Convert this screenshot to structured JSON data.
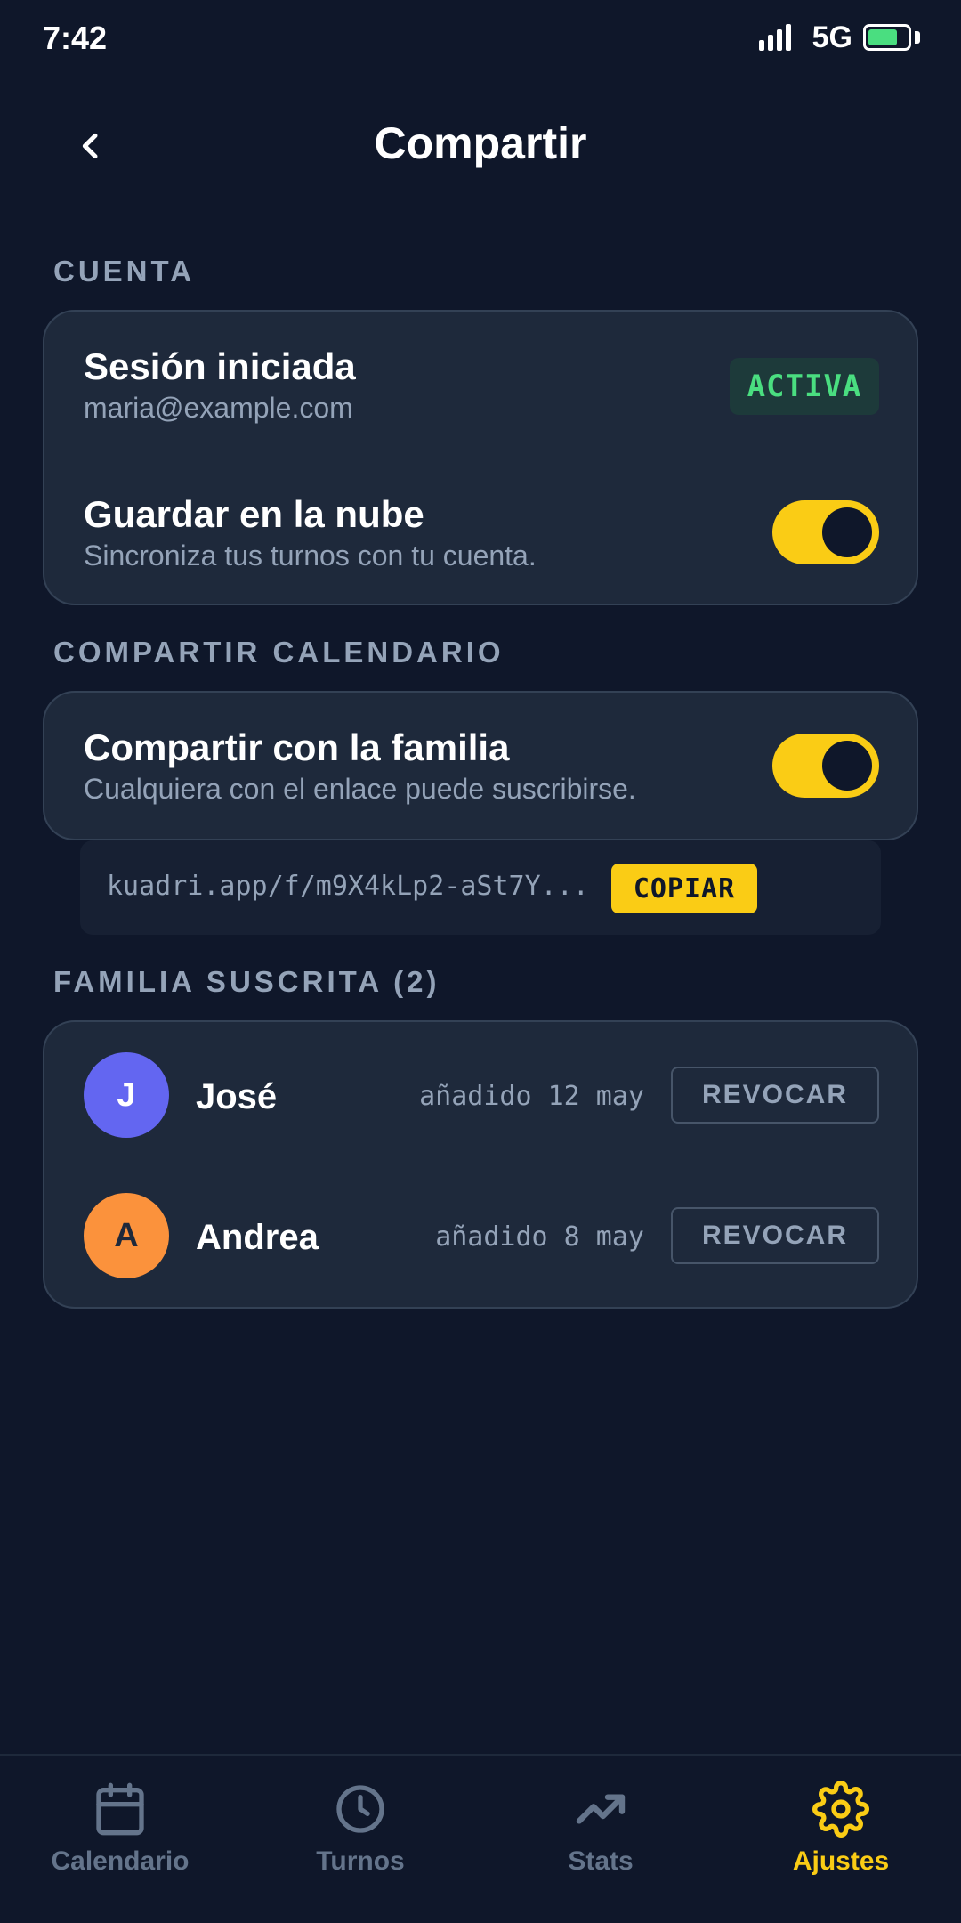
{
  "status_bar": {
    "time": "7:42",
    "network": "5G",
    "battery_level": 0.75
  },
  "header": {
    "title": "Compartir",
    "back_icon": "chevron-left-icon"
  },
  "account": {
    "section_label": "CUENTA",
    "session_title": "Sesión iniciada",
    "email": "maria@example.com",
    "status_badge": "ACTIVA",
    "cloud_title": "Guardar en la nube",
    "cloud_subtitle": "Sincroniza tus turnos con tu cuenta.",
    "cloud_enabled": true
  },
  "share_calendar": {
    "section_label": "COMPARTIR CALENDARIO",
    "family_title": "Compartir con la familia",
    "family_subtitle": "Cualquiera con el enlace puede suscribirse.",
    "family_enabled": true,
    "link": "kuadri.app/f/m9X4kLp2-aSt7Y...",
    "copy_label": "COPIAR"
  },
  "family": {
    "section_label": "FAMILIA SUSCRITA (2)",
    "members": [
      {
        "initial": "J",
        "name": "José",
        "added": "añadido 12 may",
        "revoke_label": "REVOCAR",
        "color": "#6366f1",
        "text_color": "#ffffff"
      },
      {
        "initial": "A",
        "name": "Andrea",
        "added": "añadido 8 may",
        "revoke_label": "REVOCAR",
        "color": "#fb923c",
        "text_color": "#1e293b"
      }
    ]
  },
  "nav": {
    "items": [
      {
        "label": "Calendario",
        "icon": "calendar-icon",
        "active": false
      },
      {
        "label": "Turnos",
        "icon": "clock-icon",
        "active": false
      },
      {
        "label": "Stats",
        "icon": "trending-up-icon",
        "active": false
      },
      {
        "label": "Ajustes",
        "icon": "gear-icon",
        "active": true
      }
    ]
  },
  "colors": {
    "background": "#0f172a",
    "card": "#1e293b",
    "accent": "#facc15",
    "success": "#4ade80",
    "muted": "#94a3b8"
  }
}
